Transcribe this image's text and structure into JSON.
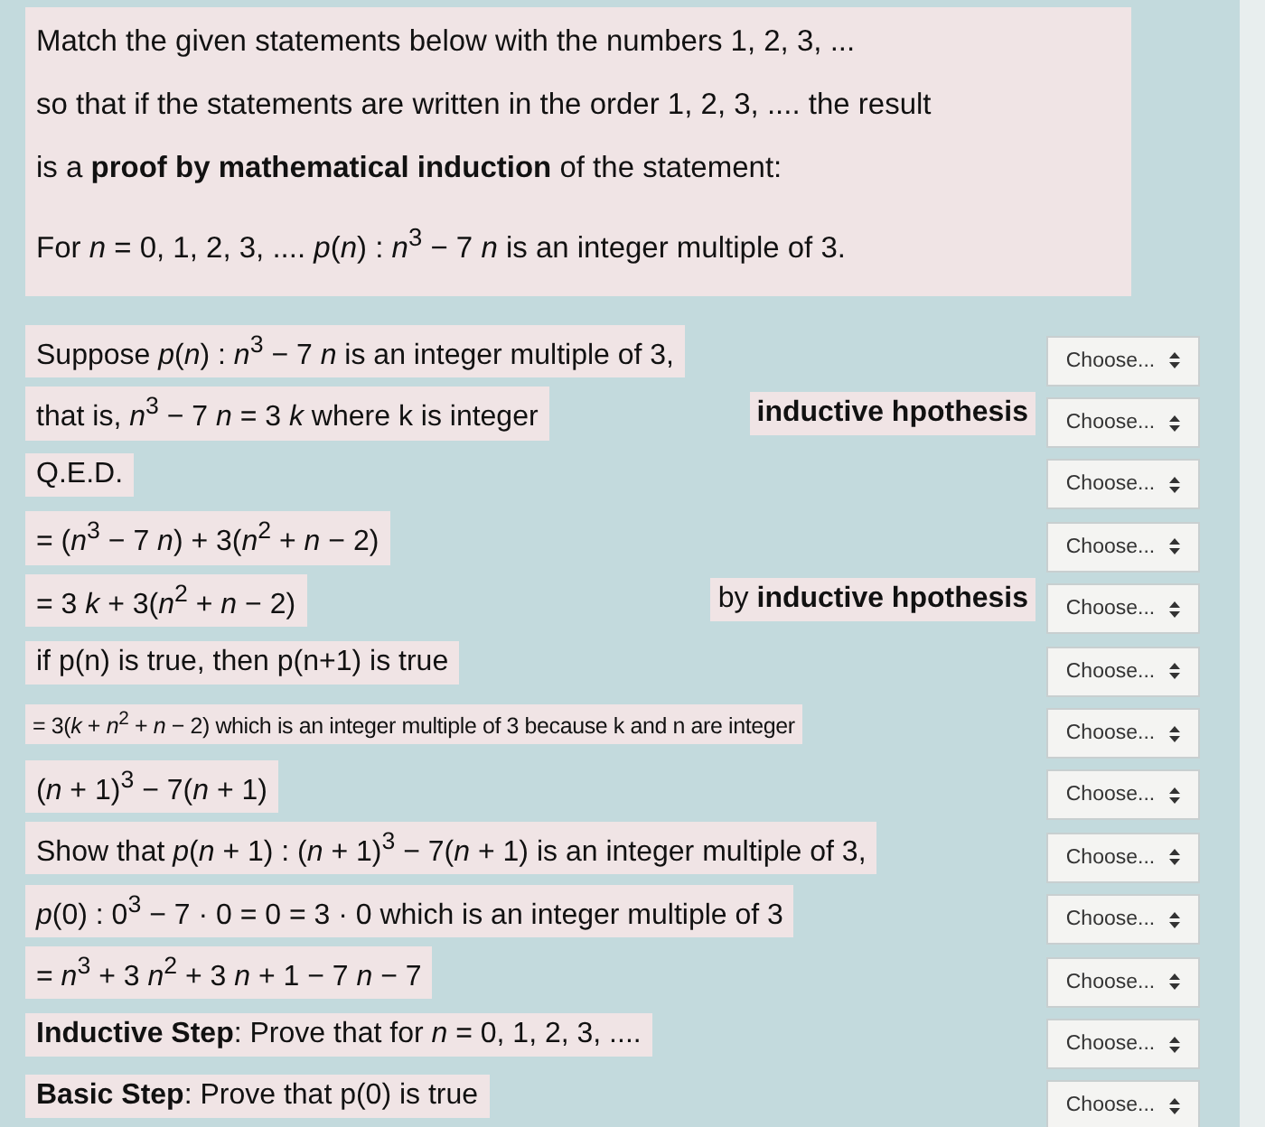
{
  "intro": {
    "lines": [
      "Match the given statements below with the numbers 1, 2, 3, ...",
      "so that if the statements are written in the order 1, 2, 3, .... the result",
      "is a **proof by mathematical induction** of the statement:"
    ],
    "statement": "For *n* = 0, 1, 2, 3, ....  *p*(*n*) : *n*$^{3}$ − 7 *n*  is an integer multiple of 3."
  },
  "rows": [
    {
      "text": "Suppose  *p*(*n*) : *n*$^{3}$ − 7 *n*  is an integer multiple of 3,",
      "select": "Choose..."
    },
    {
      "text": "that is, *n*$^{3}$ − 7 *n* = 3 *k*  where k is integer",
      "note": "**inductive hpothesis**",
      "select": "Choose..."
    },
    {
      "text": "Q.E.D.",
      "select": "Choose..."
    },
    {
      "text": "= (*n*$^{3}$ − 7 *n*) + 3(*n*$^{2}$ + *n* − 2)",
      "select": "Choose..."
    },
    {
      "text": "= 3 *k* + 3(*n*$^{2}$ + *n* − 2)",
      "note": "by **inductive hpothesis**",
      "select": "Choose..."
    },
    {
      "text": "if p(n) is true, then p(n+1) is true",
      "select": "Choose..."
    },
    {
      "text": "= 3(*k* + *n*$^{2}$ + *n* − 2)  which is an integer multiple of 3 because k and n are integer",
      "small": true,
      "select": "Choose..."
    },
    {
      "text": "(*n* + 1)$^{3}$ − 7(*n* + 1)",
      "select": "Choose..."
    },
    {
      "text": "Show that *p*(*n* + 1) : (*n* + 1)$^{3}$ − 7(*n* + 1)   is an integer multiple of 3,",
      "select": "Choose..."
    },
    {
      "text": "*p*(0) : 0$^{3}$ − 7 · 0 = 0 = 3 · 0  which is an integer multiple of 3",
      "select": "Choose..."
    },
    {
      "text": "= *n*$^{3}$ + 3 *n*$^{2}$ + 3 *n* + 1 − 7 *n* − 7",
      "select": "Choose..."
    },
    {
      "text": "**Inductive Step**: Prove that for *n* = 0, 1, 2, 3, ....",
      "select": "Choose..."
    },
    {
      "text": "**Basic Step**: Prove that p(0) is true",
      "select": "Choose..."
    }
  ]
}
